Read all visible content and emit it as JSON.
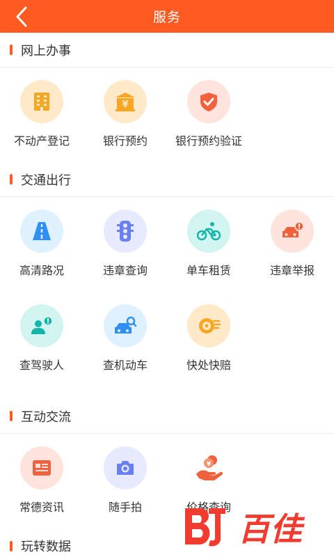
{
  "header": {
    "title": "服务",
    "back_icon": "chevron-left-icon"
  },
  "sections": [
    {
      "title": "网上办事",
      "items": [
        {
          "label": "不动产登记",
          "icon": "building-icon"
        },
        {
          "label": "银行预约",
          "icon": "bank-icon"
        },
        {
          "label": "银行预约验证",
          "icon": "shield-check-icon"
        }
      ]
    },
    {
      "title": "交通出行",
      "items": [
        {
          "label": "高清路况",
          "icon": "road-icon"
        },
        {
          "label": "违章查询",
          "icon": "traffic-light-icon"
        },
        {
          "label": "单车租赁",
          "icon": "bicycle-icon"
        },
        {
          "label": "违章举报",
          "icon": "car-alert-icon"
        },
        {
          "label": "查驾驶人",
          "icon": "driver-alert-icon"
        },
        {
          "label": "查机动车",
          "icon": "car-search-icon"
        },
        {
          "label": "快处快赔",
          "icon": "fast-compensation-icon"
        }
      ]
    },
    {
      "title": "互动交流",
      "items": [
        {
          "label": "常德资讯",
          "icon": "news-icon"
        },
        {
          "label": "随手拍",
          "icon": "camera-icon"
        },
        {
          "label": "价格查询",
          "icon": "price-hand-icon"
        }
      ]
    },
    {
      "title": "玩转数据",
      "items": []
    }
  ],
  "watermark": {
    "text": "百佳"
  },
  "colors": {
    "brand": "#ff5a22",
    "text": "#333333",
    "divider": "#ececec"
  }
}
